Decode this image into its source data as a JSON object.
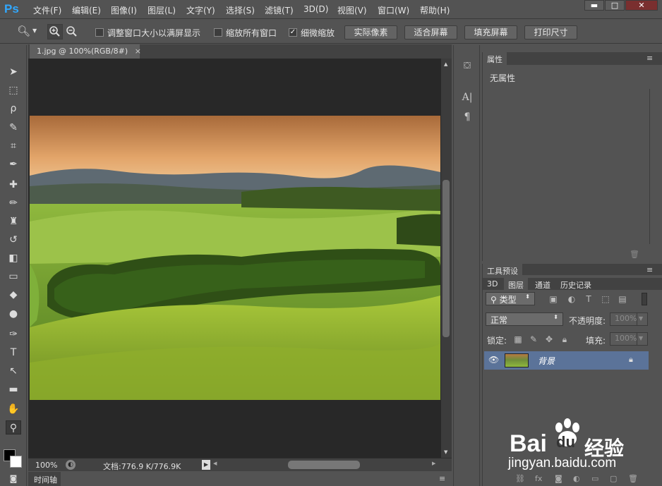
{
  "app": {
    "logo": "Ps"
  },
  "menu": [
    "文件(F)",
    "编辑(E)",
    "图像(I)",
    "图层(L)",
    "文字(Y)",
    "选择(S)",
    "滤镜(T)",
    "3D(D)",
    "视图(V)",
    "窗口(W)",
    "帮助(H)"
  ],
  "window_controls": {
    "minimize": "▬",
    "maximize": "□",
    "close": "✕"
  },
  "options": {
    "checkbox1_label": "调整窗口大小以满屏显示",
    "checkbox2_label": "缩放所有窗口",
    "checkbox3_label": "细微缩放",
    "checkbox3_checked": "✓",
    "btn_actual": "实际像素",
    "btn_fit": "适合屏幕",
    "btn_fill": "填充屏幕",
    "btn_print": "打印尺寸"
  },
  "document": {
    "tab_title": "1.jpg @ 100%(RGB/8#)",
    "tab_close": "×",
    "zoom": "100%",
    "doc_info": "文档:776.9 K/776.9K",
    "timeline_label": "时间轴"
  },
  "properties": {
    "tab": "属性",
    "no_props": "无属性"
  },
  "tool_presets": {
    "tab": "工具预设"
  },
  "layers": {
    "tabs": [
      "3D",
      "图层",
      "通道",
      "历史记录"
    ],
    "filter_kind": "类型",
    "blend_mode": "正常",
    "opacity_label": "不透明度:",
    "opacity_value": "100%",
    "lock_label": "锁定:",
    "fill_label": "填充:",
    "fill_value": "100%",
    "layer_name": "背景"
  },
  "watermark": {
    "brand": "Bai",
    "brand2": "du",
    "brand_cn": "经验",
    "url": "jingyan.baidu.com"
  },
  "colors": {
    "bg": "#535353",
    "accent": "#31a8ff",
    "selected_layer": "#5b7399"
  }
}
